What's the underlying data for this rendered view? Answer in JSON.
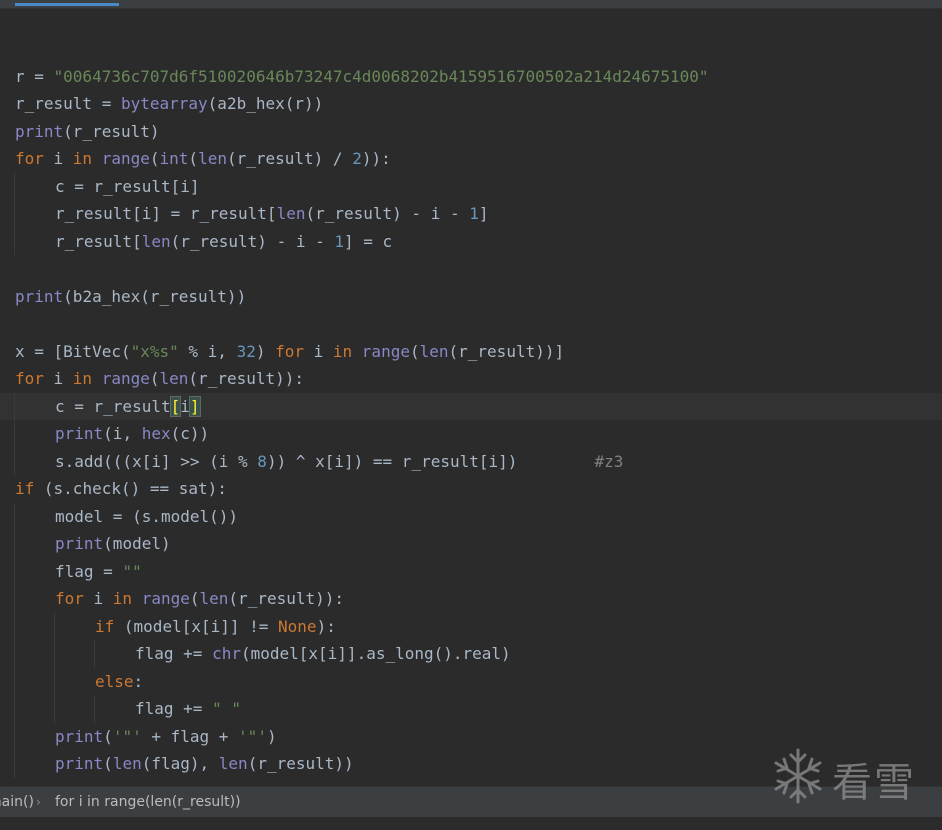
{
  "editor": {
    "lines": [
      {
        "indent": 0,
        "tokens": []
      },
      {
        "indent": 0,
        "tokens": [
          {
            "t": "r = "
          },
          {
            "t": "\"0064736c707d6f510020646b73247c4d0068202b4159516700502a214d24675100\"",
            "c": "str"
          }
        ]
      },
      {
        "indent": 0,
        "tokens": [
          {
            "t": "r_result = "
          },
          {
            "t": "bytearray",
            "c": "bi"
          },
          {
            "t": "(a2b_hex(r))"
          }
        ]
      },
      {
        "indent": 0,
        "tokens": [
          {
            "t": "print",
            "c": "bi"
          },
          {
            "t": "(r_result)"
          }
        ]
      },
      {
        "indent": 0,
        "tokens": [
          {
            "t": "for ",
            "c": "kw"
          },
          {
            "t": "i "
          },
          {
            "t": "in ",
            "c": "kw"
          },
          {
            "t": "range",
            "c": "bi"
          },
          {
            "t": "("
          },
          {
            "t": "int",
            "c": "bi"
          },
          {
            "t": "("
          },
          {
            "t": "len",
            "c": "bi"
          },
          {
            "t": "(r_result) / "
          },
          {
            "t": "2",
            "c": "num"
          },
          {
            "t": ")):"
          }
        ]
      },
      {
        "indent": 1,
        "tokens": [
          {
            "t": "c = r_result[i]"
          }
        ]
      },
      {
        "indent": 1,
        "tokens": [
          {
            "t": "r_result[i] = r_result["
          },
          {
            "t": "len",
            "c": "bi"
          },
          {
            "t": "(r_result) - i - "
          },
          {
            "t": "1",
            "c": "num"
          },
          {
            "t": "]"
          }
        ]
      },
      {
        "indent": 1,
        "tokens": [
          {
            "t": "r_result["
          },
          {
            "t": "len",
            "c": "bi"
          },
          {
            "t": "(r_result) - i - "
          },
          {
            "t": "1",
            "c": "num"
          },
          {
            "t": "] = c"
          }
        ]
      },
      {
        "indent": 0,
        "tokens": []
      },
      {
        "indent": 0,
        "tokens": [
          {
            "t": "print",
            "c": "bi"
          },
          {
            "t": "(b2a_hex(r_result))"
          }
        ]
      },
      {
        "indent": 0,
        "tokens": []
      },
      {
        "indent": 0,
        "tokens": [
          {
            "t": "x = [BitVec("
          },
          {
            "t": "\"x%s\"",
            "c": "str"
          },
          {
            "t": " % i, "
          },
          {
            "t": "32",
            "c": "num"
          },
          {
            "t": ") "
          },
          {
            "t": "for ",
            "c": "kw"
          },
          {
            "t": "i "
          },
          {
            "t": "in ",
            "c": "kw"
          },
          {
            "t": "range",
            "c": "bi"
          },
          {
            "t": "("
          },
          {
            "t": "len",
            "c": "bi"
          },
          {
            "t": "(r_result))]"
          }
        ]
      },
      {
        "indent": 0,
        "tokens": [
          {
            "t": "for ",
            "c": "kw"
          },
          {
            "t": "i "
          },
          {
            "t": "in ",
            "c": "kw"
          },
          {
            "t": "range",
            "c": "bi"
          },
          {
            "t": "("
          },
          {
            "t": "len",
            "c": "bi"
          },
          {
            "t": "(r_result)):"
          }
        ]
      },
      {
        "indent": 1,
        "current": true,
        "tokens": [
          {
            "t": "c = r_result"
          },
          {
            "t": "[",
            "c": "br"
          },
          {
            "t": "i"
          },
          {
            "t": "]",
            "c": "br"
          }
        ]
      },
      {
        "indent": 1,
        "tokens": [
          {
            "t": "print",
            "c": "bi"
          },
          {
            "t": "(i, "
          },
          {
            "t": "hex",
            "c": "bi"
          },
          {
            "t": "(c))"
          }
        ]
      },
      {
        "indent": 1,
        "tokens": [
          {
            "t": "s.add(((x[i] >> (i % "
          },
          {
            "t": "8",
            "c": "num"
          },
          {
            "t": ")) ^ x[i]) == r_result[i])        "
          },
          {
            "t": "#z3",
            "c": "cm"
          }
        ]
      },
      {
        "indent": 0,
        "tokens": [
          {
            "t": "if ",
            "c": "kw"
          },
          {
            "t": "(s.check() == sat):"
          }
        ]
      },
      {
        "indent": 1,
        "tokens": [
          {
            "t": "model = (s.model())"
          }
        ]
      },
      {
        "indent": 1,
        "tokens": [
          {
            "t": "print",
            "c": "bi"
          },
          {
            "t": "(model)"
          }
        ]
      },
      {
        "indent": 1,
        "tokens": [
          {
            "t": "flag = "
          },
          {
            "t": "\"\"",
            "c": "str"
          }
        ]
      },
      {
        "indent": 1,
        "tokens": [
          {
            "t": "for ",
            "c": "kw"
          },
          {
            "t": "i "
          },
          {
            "t": "in ",
            "c": "kw"
          },
          {
            "t": "range",
            "c": "bi"
          },
          {
            "t": "("
          },
          {
            "t": "len",
            "c": "bi"
          },
          {
            "t": "(r_result)):"
          }
        ]
      },
      {
        "indent": 2,
        "tokens": [
          {
            "t": "if ",
            "c": "kw"
          },
          {
            "t": "(model[x[i]] != "
          },
          {
            "t": "None",
            "c": "kw"
          },
          {
            "t": "):"
          }
        ]
      },
      {
        "indent": 3,
        "tokens": [
          {
            "t": "flag += "
          },
          {
            "t": "chr",
            "c": "bi"
          },
          {
            "t": "(model[x[i]].as_long().real)"
          }
        ]
      },
      {
        "indent": 2,
        "tokens": [
          {
            "t": "else",
            "c": "kw"
          },
          {
            "t": ":"
          }
        ]
      },
      {
        "indent": 3,
        "tokens": [
          {
            "t": "flag += "
          },
          {
            "t": "\" \"",
            "c": "str"
          }
        ]
      },
      {
        "indent": 1,
        "tokens": [
          {
            "t": "print",
            "c": "bi"
          },
          {
            "t": "("
          },
          {
            "t": "'\"'",
            "c": "str"
          },
          {
            "t": " + flag + "
          },
          {
            "t": "'\"'",
            "c": "str"
          },
          {
            "t": ")"
          }
        ]
      },
      {
        "indent": 1,
        "tokens": [
          {
            "t": "print",
            "c": "bi"
          },
          {
            "t": "("
          },
          {
            "t": "len",
            "c": "bi"
          },
          {
            "t": "(flag), "
          },
          {
            "t": "len",
            "c": "bi"
          },
          {
            "t": "(r_result))"
          }
        ]
      }
    ]
  },
  "breadcrumb": {
    "first": "main()",
    "separator": "›",
    "second": "for i in range(len(r_result))"
  },
  "watermark": {
    "text": "看雪",
    "icon": "snowflake-icon"
  }
}
